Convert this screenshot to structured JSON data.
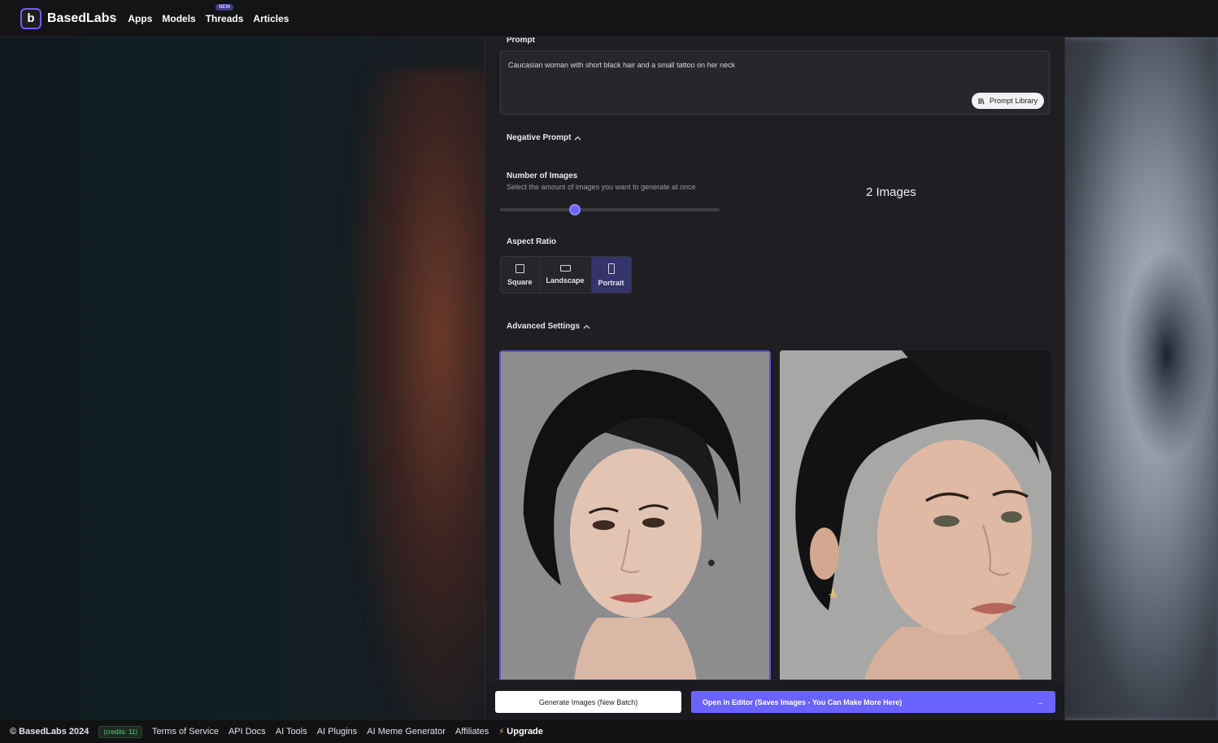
{
  "header": {
    "brand": "BasedLabs",
    "logo_glyph": "b",
    "nav": [
      {
        "label": "Apps"
      },
      {
        "label": "Models"
      },
      {
        "label": "Threads",
        "badge": "NEW"
      },
      {
        "label": "Articles"
      }
    ]
  },
  "form": {
    "prompt_label": "Prompt",
    "prompt_value": "Caucasian woman with short black hair and a small tattoo on her neck",
    "prompt_library_label": "Prompt Library",
    "negative_prompt_label": "Negative Prompt",
    "number_of_images_label": "Number of Images",
    "number_of_images_sub": "Select the amount of images you want to generate at once",
    "slider_fraction": 0.34,
    "images_count_label": "2 Images",
    "aspect_ratio_label": "Aspect Ratio",
    "aspect_ratios": [
      {
        "label": "Square",
        "icon": "square-icon",
        "active": false
      },
      {
        "label": "Landscape",
        "icon": "landscape-icon",
        "active": false
      },
      {
        "label": "Portrait",
        "icon": "portrait-icon",
        "active": true
      }
    ],
    "advanced_settings_label": "Advanced Settings"
  },
  "actions": {
    "generate_label": "Generate Images (New Batch)",
    "open_editor_label": "Open in Editor (Saves Images - You Can Make More Here)",
    "open_editor_arrow": "→"
  },
  "footer": {
    "copyright": "© BasedLabs 2024",
    "credits": "(credits: 11)",
    "links": [
      "Terms of Service",
      "API Docs",
      "AI Tools",
      "AI Plugins",
      "AI Meme Generator",
      "Affiliates"
    ],
    "upgrade_label": "Upgrade"
  },
  "colors": {
    "accent": "#6a63ff",
    "panel": "#1f1f23",
    "credits": "#5ad17a"
  }
}
